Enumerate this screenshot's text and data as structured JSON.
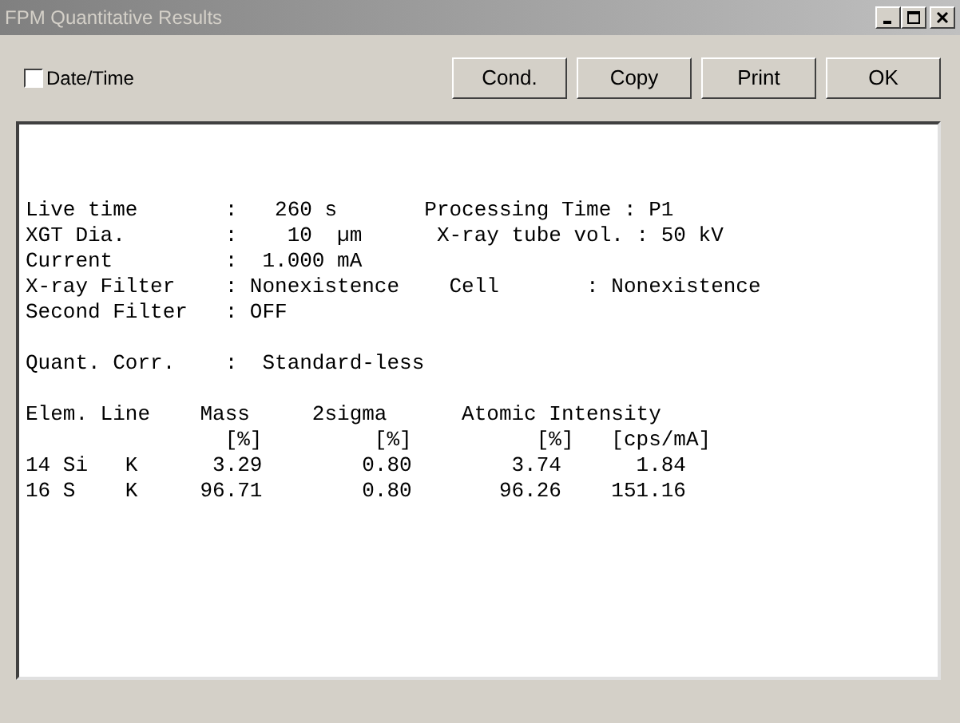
{
  "window": {
    "title": "FPM Quantitative Results"
  },
  "toolbar": {
    "checkbox": {
      "label": "Date/Time",
      "checked": false
    },
    "buttons": [
      "Cond.",
      "Copy",
      "Print",
      "OK"
    ]
  },
  "report": {
    "blocks": [
      {
        "lines": [
          "Live time       :   260 s       Processing Time : P1",
          "XGT Dia.        :    10  µm      X-ray tube vol. : 50 kV",
          "Current         :  1.000 mA",
          "X-ray Filter    : Nonexistence    Cell       : Nonexistence",
          "Second Filter   : OFF"
        ]
      },
      {
        "lines": [
          "Quant. Corr.    :  Standard-less"
        ]
      },
      {
        "lines": [
          "Elem. Line    Mass     2sigma      Atomic Intensity",
          "                [%]         [%]          [%]   [cps/mA]",
          "14 Si   K      3.29        0.80        3.74      1.84",
          "16 S    K     96.71        0.80       96.26    151.16"
        ]
      }
    ]
  }
}
